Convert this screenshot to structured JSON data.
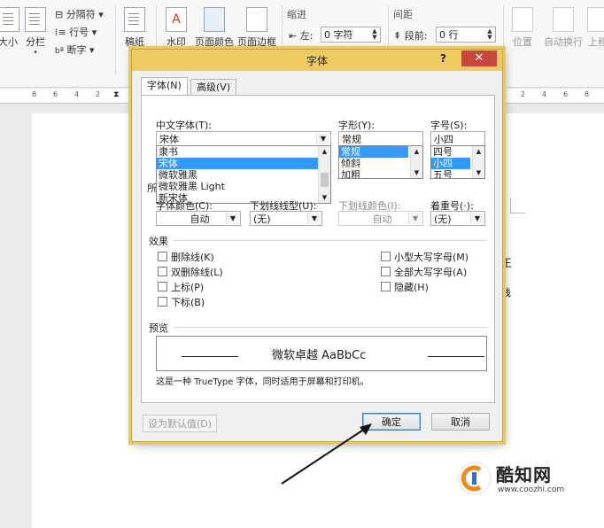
{
  "ribbon": {
    "size_label": "大小",
    "columns_label": "分栏",
    "breaks_label": "分隔符",
    "line_numbers_label": "行号",
    "hyphenation_label": "断字",
    "draft_label": "稿纸",
    "watermark_label": "水印",
    "page_color_label": "页面颜色",
    "page_border_label": "页面边框",
    "indent_title": "缩进",
    "indent_left_label": "左:",
    "indent_left_value": "0 字符",
    "spacing_title": "间距",
    "spacing_before_label": "段前:",
    "spacing_before_value": "0 行",
    "position_label": "位置",
    "wrap_text_label": "自动换行",
    "bring_forward_label": "上移"
  },
  "ruler": {
    "marks": [
      "8",
      "6",
      "4",
      "2",
      "2",
      "4",
      "6",
      "8"
    ]
  },
  "page": {
    "edge_chars": [
      "王",
      "栈"
    ]
  },
  "dialog": {
    "title": "字体",
    "help": "?",
    "close": "✕",
    "tabs": [
      {
        "label": "字体(N)"
      },
      {
        "label": "高级(V)"
      }
    ],
    "cn_font_label": "中文字体(T):",
    "cn_font_value": "宋体",
    "cn_font_list": [
      "隶书",
      "宋体",
      "微软雅黑",
      "微软雅黑 Light",
      "新宋体"
    ],
    "cn_font_selected_index": 1,
    "style_label": "字形(Y):",
    "style_value": "常规",
    "style_list": [
      "常规",
      "倾斜",
      "加粗"
    ],
    "size_label": "字号(S):",
    "size_value": "小四",
    "size_list": [
      "四号",
      "小四",
      "五号"
    ],
    "size_selected_index": 1,
    "western_partial": "所",
    "font_color_label": "字体颜色(C):",
    "font_color_value": "自动",
    "underline_label": "下划线线型(U):",
    "underline_value": "(无)",
    "underline_color_label": "下划线颜色(I):",
    "underline_color_value": "自动",
    "emphasis_label": "着重号(·):",
    "emphasis_value": "(无)",
    "effects_title": "效果",
    "effects_left": [
      "删除线(K)",
      "双删除线(L)",
      "上标(P)",
      "下标(B)"
    ],
    "effects_right": [
      "小型大写字母(M)",
      "全部大写字母(A)",
      "隐藏(H)"
    ],
    "preview_title": "预览",
    "preview_text": "微软卓越 AaBbCc",
    "preview_note": "这是一种 TrueType 字体，同时适用于屏幕和打印机。",
    "set_default_label": "设为默认值(D)",
    "ok_label": "确定",
    "cancel_label": "取消"
  },
  "watermark": {
    "brand": "酷知网",
    "url": "www.coozhi.com"
  }
}
